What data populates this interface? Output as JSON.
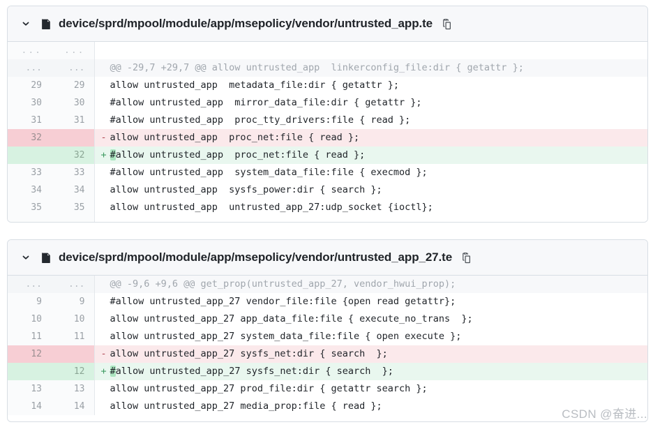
{
  "colors": {
    "add_bg": "#e9f7ef",
    "del_bg": "#fbe9eb",
    "add_gutter": "#d7f2e1",
    "del_gutter": "#f7ced4",
    "hunk_bg": "#f7f8fa",
    "border": "#d8dee4",
    "text": "#1f2328",
    "muted": "#9aa0a6",
    "word_highlight": "#abe6c0"
  },
  "watermark": "CSDN @奋进...",
  "icons": {
    "chevron": "chevron-down-icon",
    "file": "file-icon",
    "copy": "copy-path-icon"
  },
  "files": [
    {
      "path": "device/sprd/mpool/module/app/msepolicy/vendor/untrusted_app.te",
      "rows": [
        {
          "type": "dots",
          "old": "...",
          "new": "...",
          "mark": "",
          "code": ""
        },
        {
          "type": "hunk",
          "old": "...",
          "new": "...",
          "mark": "",
          "code": "@@ -29,7 +29,7 @@ allow untrusted_app  linkerconfig_file:dir { getattr };"
        },
        {
          "type": "ctx",
          "old": "29",
          "new": "29",
          "mark": " ",
          "code": "allow untrusted_app  metadata_file:dir { getattr };"
        },
        {
          "type": "ctx",
          "old": "30",
          "new": "30",
          "mark": " ",
          "code": "#allow untrusted_app  mirror_data_file:dir { getattr };"
        },
        {
          "type": "ctx",
          "old": "31",
          "new": "31",
          "mark": " ",
          "code": "#allow untrusted_app  proc_tty_drivers:file { read };"
        },
        {
          "type": "del",
          "old": "32",
          "new": "",
          "mark": "-",
          "code": "allow untrusted_app  proc_net:file { read };"
        },
        {
          "type": "add",
          "old": "",
          "new": "32",
          "mark": "+",
          "code": "#allow untrusted_app  proc_net:file { read };",
          "hl_prefix": "#",
          "hl_rest": "allow untrusted_app  proc_net:file { read };"
        },
        {
          "type": "ctx",
          "old": "33",
          "new": "33",
          "mark": " ",
          "code": "#allow untrusted_app  system_data_file:file { execmod };"
        },
        {
          "type": "ctx",
          "old": "34",
          "new": "34",
          "mark": " ",
          "code": "allow untrusted_app  sysfs_power:dir { search };"
        },
        {
          "type": "ctx",
          "old": "35",
          "new": "35",
          "mark": " ",
          "code": "allow untrusted_app  untrusted_app_27:udp_socket {ioctl};"
        },
        {
          "type": "dots",
          "old": "...",
          "new": "...",
          "mark": "",
          "code": ""
        }
      ]
    },
    {
      "path": "device/sprd/mpool/module/app/msepolicy/vendor/untrusted_app_27.te",
      "rows": [
        {
          "type": "hunk",
          "old": "...",
          "new": "...",
          "mark": "",
          "code": "@@ -9,6 +9,6 @@ get_prop(untrusted_app_27, vendor_hwui_prop);"
        },
        {
          "type": "ctx",
          "old": "9",
          "new": "9",
          "mark": " ",
          "code": "#allow untrusted_app_27 vendor_file:file {open read getattr};"
        },
        {
          "type": "ctx",
          "old": "10",
          "new": "10",
          "mark": " ",
          "code": "allow untrusted_app_27 app_data_file:file { execute_no_trans  };"
        },
        {
          "type": "ctx",
          "old": "11",
          "new": "11",
          "mark": " ",
          "code": "allow untrusted_app_27 system_data_file:file { open execute };"
        },
        {
          "type": "del",
          "old": "12",
          "new": "",
          "mark": "-",
          "code": "allow untrusted_app_27 sysfs_net:dir { search  };"
        },
        {
          "type": "add",
          "old": "",
          "new": "12",
          "mark": "+",
          "code": "#allow untrusted_app_27 sysfs_net:dir { search  };",
          "hl_prefix": "#",
          "hl_rest": "allow untrusted_app_27 sysfs_net:dir { search  };"
        },
        {
          "type": "ctx",
          "old": "13",
          "new": "13",
          "mark": " ",
          "code": "allow untrusted_app_27 prod_file:dir { getattr search };"
        },
        {
          "type": "ctx",
          "old": "14",
          "new": "14",
          "mark": " ",
          "code": "allow untrusted_app_27 media_prop:file { read };"
        }
      ]
    }
  ]
}
